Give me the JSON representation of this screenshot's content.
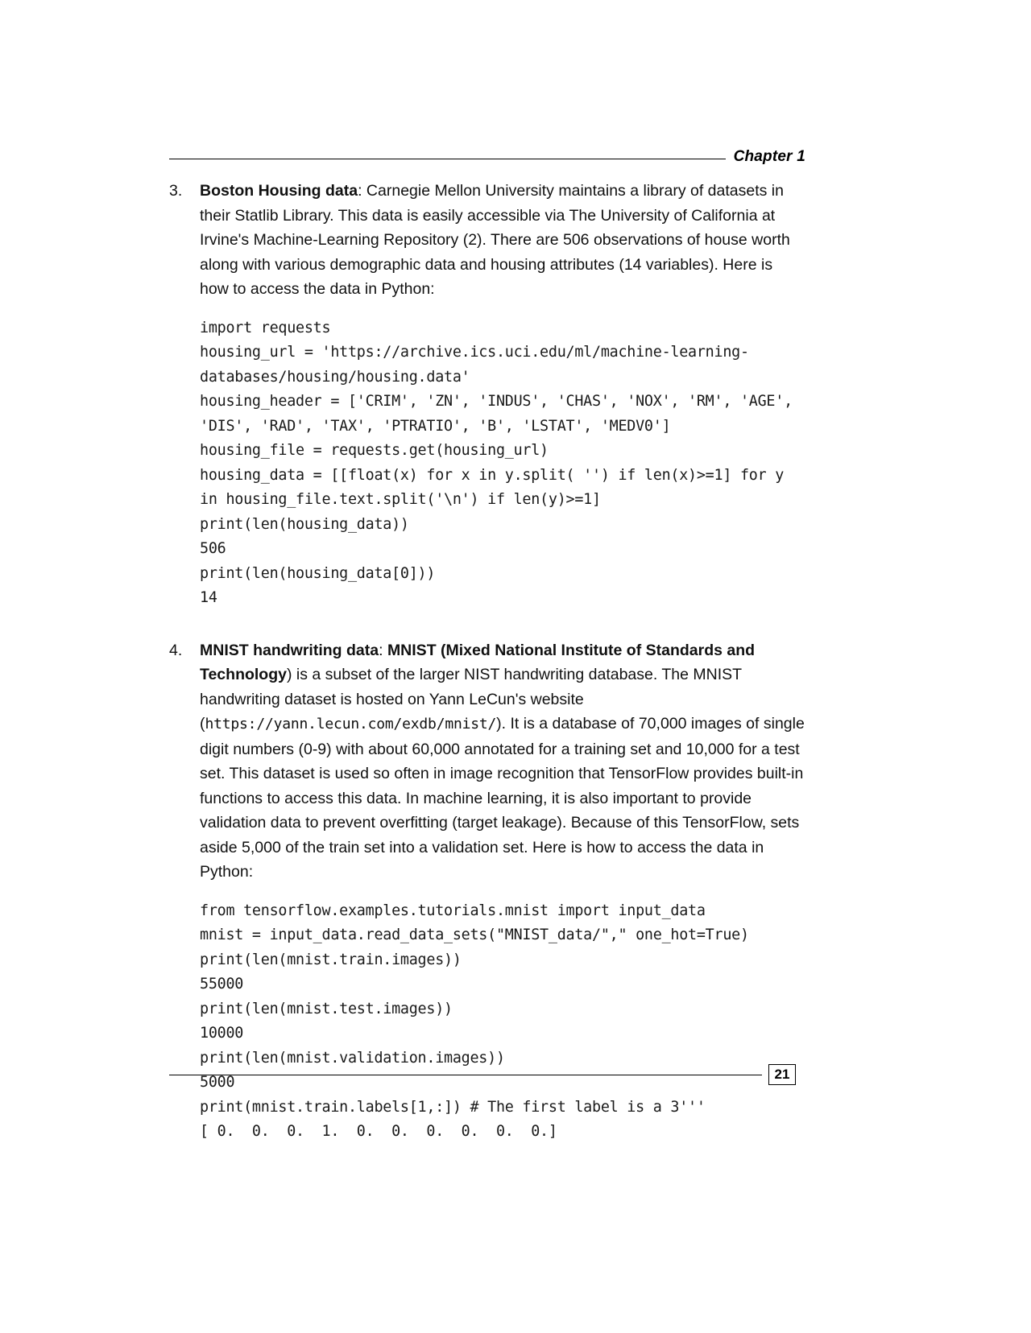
{
  "header": {
    "chapter_label": "Chapter 1"
  },
  "items": [
    {
      "number": "3.",
      "title": "Boston Housing data",
      "title_suffix": ": ",
      "body": "Carnegie Mellon University maintains a library of datasets in their Statlib Library. This data is easily accessible via The University of California at Irvine's Machine-Learning Repository (2). There are 506 observations of house worth along with various demographic data and housing attributes (14 variables). Here is how to access the data in Python:",
      "code": "import requests\nhousing_url = 'https://archive.ics.uci.edu/ml/machine-learning-databases/housing/housing.data'\nhousing_header = ['CRIM', 'ZN', 'INDUS', 'CHAS', 'NOX', 'RM', 'AGE', 'DIS', 'RAD', 'TAX', 'PTRATIO', 'B', 'LSTAT', 'MEDV0']\nhousing_file = requests.get(housing_url)\nhousing_data = [[float(x) for x in y.split( '') if len(x)>=1] for y in housing_file.text.split('\\n') if len(y)>=1]\nprint(len(housing_data))\n506\nprint(len(housing_data[0]))\n14"
    },
    {
      "number": "4.",
      "title": "MNIST handwriting data",
      "title_suffix": ": ",
      "title_bold_2": "MNIST (Mixed National Institute of Standards and Technology",
      "body_part_1": ") is a subset of the larger NIST handwriting database. The MNIST handwriting dataset is hosted on Yann LeCun's website (",
      "url_mono_1": "https://yann.lecun.com/exdb/mnist/",
      "body_part_2": "). It is a database of 70,000 images of single digit numbers (0-9) with about 60,000 annotated for a training set and 10,000 for a test set. This dataset is used so often in image recognition that TensorFlow provides built-in functions to access this data. In machine learning, it is also important to provide validation data to prevent overfitting (target leakage). Because of this TensorFlow, sets aside 5,000 of the train set into a validation set. Here is how to access the data in Python:",
      "code": "from tensorflow.examples.tutorials.mnist import input_data\nmnist = input_data.read_data_sets(\"MNIST_data/\",\" one_hot=True)\nprint(len(mnist.train.images))\n55000\nprint(len(mnist.test.images))\n10000\nprint(len(mnist.validation.images))\n5000\nprint(mnist.train.labels[1,:]) # The first label is a 3'''\n[ 0.  0.  0.  1.  0.  0.  0.  0.  0.  0.]"
    }
  ],
  "footer": {
    "page_number": "21"
  }
}
